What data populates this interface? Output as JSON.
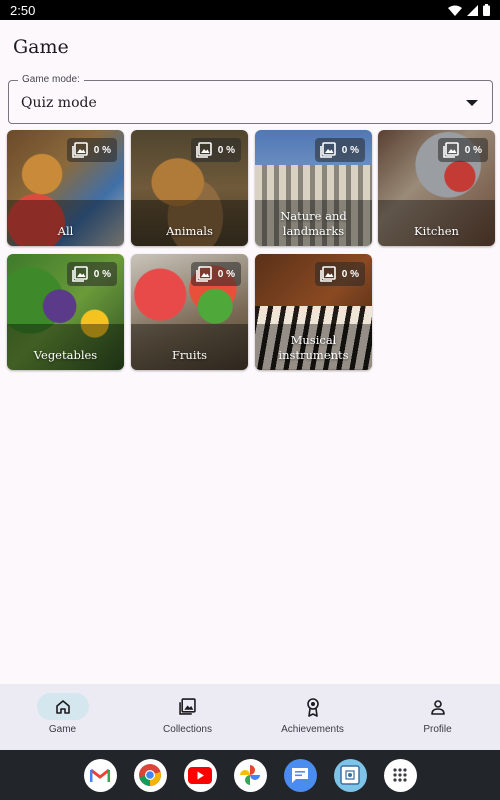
{
  "status_bar": {
    "time": "2:50"
  },
  "page": {
    "title": "Game"
  },
  "mode_select": {
    "label": "Game mode:",
    "value": "Quiz mode"
  },
  "categories": [
    {
      "name": "All",
      "progress": "0 %"
    },
    {
      "name": "Animals",
      "progress": "0 %"
    },
    {
      "name": "Nature and landmarks",
      "progress": "0 %"
    },
    {
      "name": "Kitchen",
      "progress": "0 %"
    },
    {
      "name": "Vegetables",
      "progress": "0 %"
    },
    {
      "name": "Fruits",
      "progress": "0 %"
    },
    {
      "name": "Musical instruments",
      "progress": "0 %"
    }
  ],
  "bottom_nav": {
    "active": "Game",
    "items": [
      {
        "label": "Game",
        "icon": "home-icon"
      },
      {
        "label": "Collections",
        "icon": "photo-library-icon"
      },
      {
        "label": "Achievements",
        "icon": "award-icon"
      },
      {
        "label": "Profile",
        "icon": "person-icon"
      }
    ]
  },
  "dock": {
    "apps": [
      "gmail-icon",
      "chrome-icon",
      "youtube-icon",
      "photos-icon",
      "messages-icon",
      "puzzle-app-icon",
      "app-drawer-icon"
    ]
  },
  "colors": {
    "active_pill": "#d4e6ee",
    "nav_bg": "#eceaf2",
    "dock_bg": "#22262b",
    "page_bg": "#fdf8fc"
  }
}
